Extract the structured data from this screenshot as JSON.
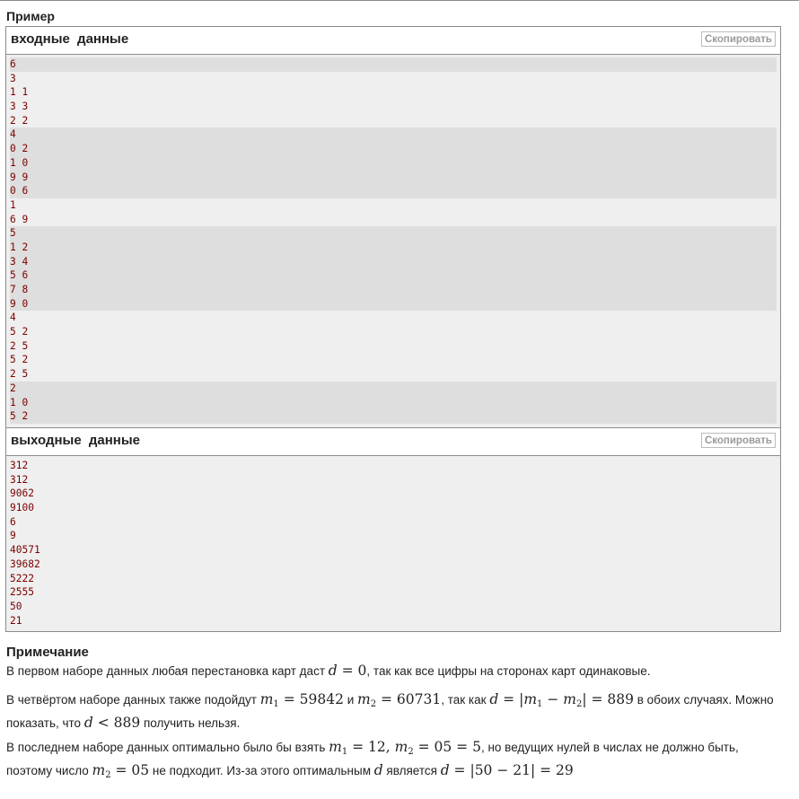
{
  "section_title": "Пример",
  "input": {
    "title": "входные данные",
    "copy_label": "Скопировать",
    "groups": [
      [
        "6"
      ],
      [
        "3",
        "1 1",
        "3 3",
        "2 2"
      ],
      [
        "4",
        "0 2",
        "1 0",
        "9 9",
        "0 6"
      ],
      [
        "1",
        "6 9"
      ],
      [
        "5",
        "1 2",
        "3 4",
        "5 6",
        "7 8",
        "9 0"
      ],
      [
        "4",
        "5 2",
        "2 5",
        "5 2",
        "2 5"
      ],
      [
        "2",
        "1 0",
        "5 2"
      ]
    ]
  },
  "output": {
    "title": "выходные данные",
    "copy_label": "Скопировать",
    "lines": [
      "312",
      "312",
      "9062",
      "9100",
      "6",
      "9",
      "40571",
      "39682",
      "5222",
      "2555",
      "50",
      "21"
    ]
  },
  "note": {
    "title": "Примечание",
    "p1": {
      "a": "В первом наборе данных любая перестановка карт даст ",
      "math_d": "d",
      "math_eq": " = 0",
      "b": ", так как все цифры на сторонах карт одинаковые."
    },
    "p2": {
      "a": "В четвёртом наборе данных также подойдут ",
      "m1": "m",
      "m1_sub": "1",
      "m1_val": " = 59842",
      "and": " и ",
      "m2": "m",
      "m2_sub": "2",
      "m2_val": " = 60731",
      "b": ", так как ",
      "d": "d",
      "expr_a": " = |",
      "e_m1": "m",
      "e_m1_sub": "1",
      "minus": " − ",
      "e_m2": "m",
      "e_m2_sub": "2",
      "expr_b": "| = 889",
      "c": " в обоих случаях. Можно",
      "d_line2_a": "показать, что ",
      "d2": "d",
      "lt": " < 889",
      "d_line2_b": " получить нельзя."
    },
    "p3": {
      "a": "В последнем наборе данных оптимально было бы взять ",
      "m1": "m",
      "m1_sub": "1",
      "m1_val": " = 12, ",
      "m2": "m",
      "m2_sub": "2",
      "m2_val": " = 05 = 5",
      "b": ", но ведущих нулей в числах не должно быть,",
      "line2_a": "поэтому число ",
      "m2b": "m",
      "m2b_sub": "2",
      "m2b_val": " = 05",
      "line2_b": " не подходит. Из-за этого оптимальным ",
      "d": "d",
      "line2_c": " является ",
      "d2": "d",
      "final": " = |50 − 21| = 29"
    }
  }
}
